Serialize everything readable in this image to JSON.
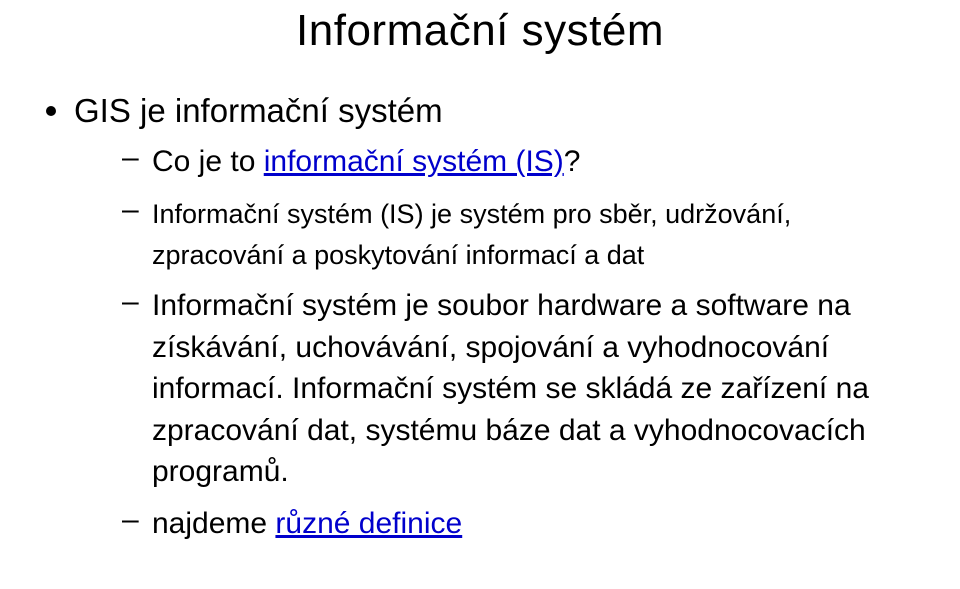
{
  "slide": {
    "title": "Informační systém",
    "bullets": [
      {
        "text": "GIS je informační systém",
        "children": [
          {
            "prefix": "Co je to ",
            "link": "informační systém (IS)",
            "suffix": "?",
            "size": "normal"
          },
          {
            "text": "Informační systém (IS) je systém pro sběr, udržování, zpracování a poskytování informací a dat",
            "size": "small"
          },
          {
            "text": "Informační systém je soubor hardware a software na získávání, uchovávání, spojování a vyhodnocování informací. Informační systém se skládá ze zařízení na zpracování dat, systému báze dat a vyhodnocovacích programů.",
            "size": "normal"
          },
          {
            "prefix": "najdeme ",
            "link": "různé definice",
            "suffix": "",
            "size": "normal"
          }
        ]
      }
    ]
  }
}
